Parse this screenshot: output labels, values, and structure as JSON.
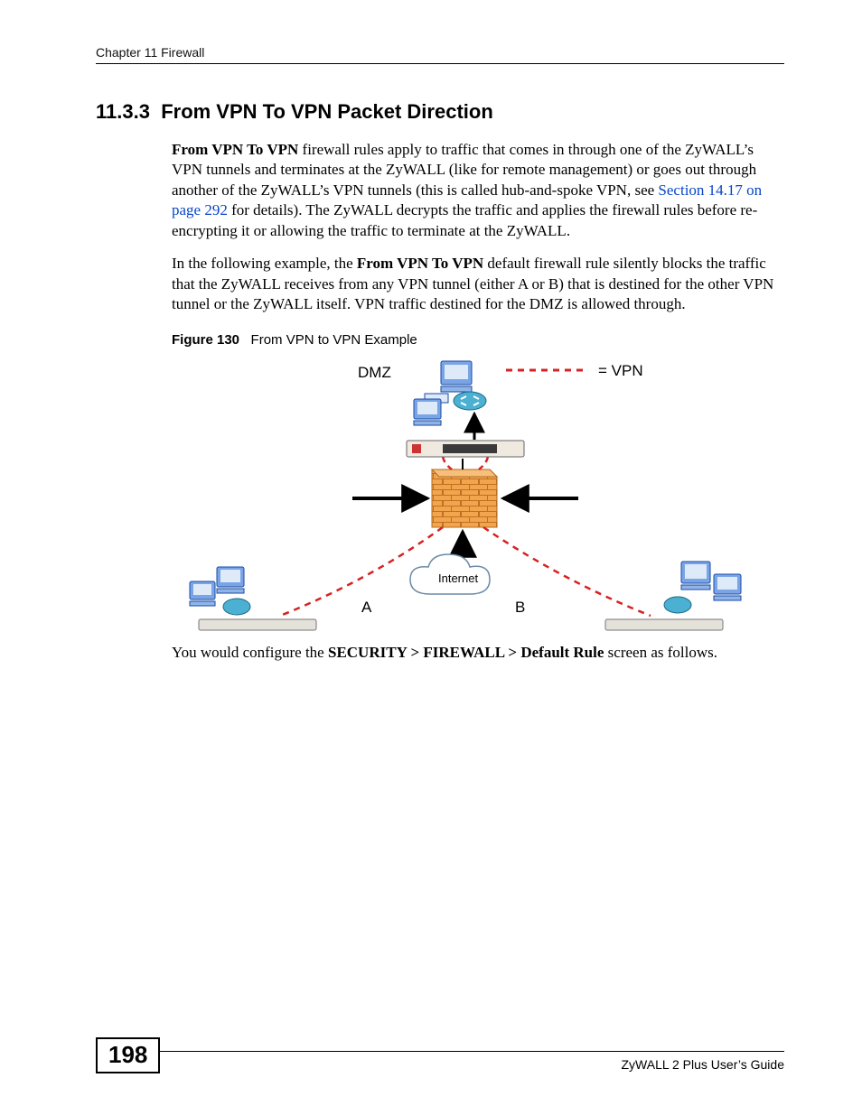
{
  "header": {
    "chapter_line": "Chapter 11 Firewall"
  },
  "section": {
    "number": "11.3.3",
    "title": "From VPN To VPN Packet Direction"
  },
  "para1": {
    "lead_bold": "From VPN To VPN",
    "rest_before_link": " firewall rules apply to traffic that comes in through one of the ZyWALL’s VPN tunnels and terminates at the ZyWALL (like for remote management) or goes out through another of the ZyWALL’s VPN tunnels (this is called hub-and-spoke VPN, see ",
    "link_text": "Section 14.17 on page 292",
    "rest_after_link": " for details). The ZyWALL decrypts the traffic and applies the firewall rules before re-encrypting it or allowing the traffic to terminate at the ZyWALL."
  },
  "para2": {
    "before_bold": "In the following example, the ",
    "bold": "From VPN To VPN",
    "after_bold": " default firewall rule silently blocks the traffic that the ZyWALL receives from any VPN tunnel (either A or B) that is destined for the other VPN tunnel or the ZyWALL itself. VPN traffic destined for the DMZ is allowed through."
  },
  "figure": {
    "caption_label": "Figure 130",
    "caption_text": "From VPN to VPN Example",
    "labels": {
      "dmz": "DMZ",
      "vpn_legend": "= VPN",
      "internet": "Internet",
      "a": "A",
      "b": "B"
    }
  },
  "para3": {
    "before": "You would configure the ",
    "bold": "SECURITY > FIREWALL > Default Rule",
    "after": " screen as follows."
  },
  "footer": {
    "page_number": "198",
    "guide": "ZyWALL 2 Plus User’s Guide"
  }
}
